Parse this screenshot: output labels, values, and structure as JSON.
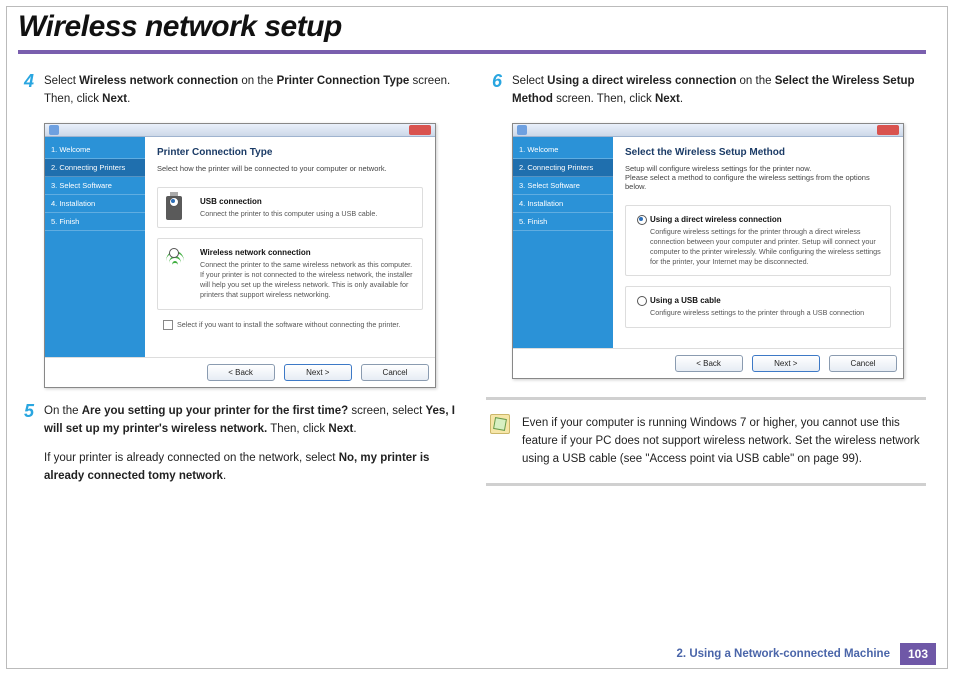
{
  "page": {
    "title": "Wireless network setup",
    "chapter_label": "2.  Using a Network-connected Machine",
    "page_number": "103"
  },
  "steps": {
    "s4": {
      "num": "4",
      "t1": "Select ",
      "b1": "Wireless network connection",
      "t2": " on the ",
      "b2": "Printer Connection Type",
      "t3": " screen. Then, click ",
      "b3": "Next",
      "t4": "."
    },
    "s5": {
      "num": "5",
      "t1": "On the ",
      "b1": "Are you setting up your printer for the first time?",
      "t2": " screen, select ",
      "b2": "Yes, I will set up my printer's wireless network.",
      "t3": " Then, click ",
      "b3": "Next",
      "t4": ".",
      "p2a": "If your printer is already connected on the network, select ",
      "p2b": "No, my printer is already connected tomy network",
      "p2c": "."
    },
    "s6": {
      "num": "6",
      "t1": "Select ",
      "b1": "Using a direct wireless connection",
      "t2": " on the ",
      "b2": "Select the Wireless Setup Method",
      "t3": " screen. Then, click ",
      "b3": "Next",
      "t4": "."
    }
  },
  "installer": {
    "sidebar": {
      "i1": "1. Welcome",
      "i2": "2. Connecting Printers",
      "i3": "3. Select Software",
      "i4": "4. Installation",
      "i5": "5. Finish"
    },
    "w1": {
      "title": "Printer Connection Type",
      "sub": "Select how the printer will be connected to your computer or network.",
      "opt_usb_label": "USB connection",
      "opt_usb_desc": "Connect the printer to this computer using a USB cable.",
      "opt_wifi_label": "Wireless network connection",
      "opt_wifi_desc": "Connect the printer to the same wireless network as this computer.\nIf your printer is not connected to the wireless network, the installer will help you set up the wireless network. This is only available for printers that support wireless networking.",
      "chk": "Select if you want to install the software without connecting the printer."
    },
    "w2": {
      "title": "Select the Wireless Setup Method",
      "sub": "Setup will configure wireless settings for the printer now.",
      "sub2": "Please select a method to configure the wireless settings from the options below.",
      "opt1_label": "Using a direct wireless connection",
      "opt1_desc": "Configure wireless settings for the printer through a direct wireless connection between your computer and printer. Setup will connect your computer to the printer wirelessly.\nWhile configuring the wireless settings for the printer, your Internet may be disconnected.",
      "opt2_label": "Using a USB cable",
      "opt2_desc": "Configure wireless settings to the printer through a USB connection"
    },
    "btn_back": "< Back",
    "btn_next": "Next >",
    "btn_cancel": "Cancel"
  },
  "note": {
    "text": "Even if your computer is running Windows 7 or higher, you cannot use this feature if your PC does not support wireless network. Set the wireless network using a USB cable (see \"Access point via USB cable\" on page 99)."
  }
}
